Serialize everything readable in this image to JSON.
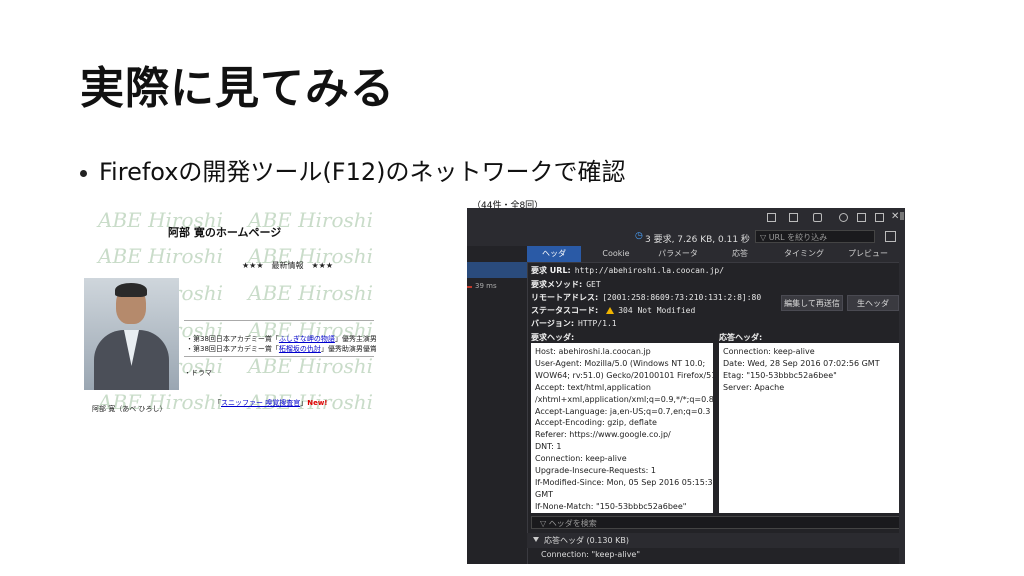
{
  "slide": {
    "title": "実際に見てみる",
    "bullet": "Firefoxの開発ツール(F12)のネットワークで確認"
  },
  "homepage": {
    "title": "阿部 寛のホームページ",
    "latest": "★★★　最新情報　★★★",
    "watermark": "ABE Hiroshi",
    "awards": [
      {
        "prefix": "・第38回日本アカデミー賞「",
        "link": "ふしぎな岬の物語",
        "suffix": "」優秀主演男優賞　受賞"
      },
      {
        "prefix": "・第38回日本アカデミー賞「",
        "link": "柘榴坂の仇討",
        "suffix": "」優秀助演男優賞　受賞"
      }
    ],
    "drama": "・ドラマ",
    "sniffer": {
      "prefix": "「",
      "link": "スニッファー 嗅覚捜査官",
      "suffix": "」",
      "new": "New!"
    },
    "name": "阿部 寛（あべ ひろし）"
  },
  "devtools": {
    "above_text": "（44件・全8回）",
    "stats": "3 要求, 7.26 KB, 0.11 秒",
    "filter_placeholder": "URL を絞り込み",
    "timing_left": "39 ms",
    "tabs": [
      "ヘッダ",
      "Cookie",
      "パラメータ",
      "応答",
      "タイミング",
      "プレビュー"
    ],
    "active_tab": "ヘッダ",
    "request_url": {
      "label": "要求 URL:",
      "value": "http://abehiroshi.la.coocan.jp/"
    },
    "request_method": {
      "label": "要求メソッド:",
      "value": "GET"
    },
    "remote_address": {
      "label": "リモートアドレス:",
      "value": "[2001:258:8609:73:210:131:2:8]:80"
    },
    "status_code": {
      "label": "ステータスコード:",
      "value": "304  Not Modified"
    },
    "version": {
      "label": "バージョン:",
      "value": "HTTP/1.1"
    },
    "buttons": {
      "edit_resend": "編集して再送信",
      "raw_headers": "生ヘッダ"
    },
    "request_headers_label": "要求ヘッダ:",
    "response_headers_label": "応答ヘッダ:",
    "request_headers": [
      "Host: abehiroshi.la.coocan.jp",
      "User-Agent: Mozilla/5.0 (Windows NT 10.0;",
      "WOW64; rv:51.0) Gecko/20100101 Firefox/51.0",
      "Accept: text/html,application",
      "/xhtml+xml,application/xml;q=0.9,*/*;q=0.8",
      "Accept-Language: ja,en-US;q=0.7,en;q=0.3",
      "Accept-Encoding: gzip, deflate",
      "Referer: https://www.google.co.jp/",
      "DNT: 1",
      "Connection: keep-alive",
      "Upgrade-Insecure-Requests: 1",
      "If-Modified-Since: Mon, 05 Sep 2016 05:15:36",
      "GMT",
      "If-None-Match: \"150-53bbbc52a6bee\""
    ],
    "response_headers": [
      "Connection: keep-alive",
      "Date: Wed, 28 Sep 2016 07:02:56 GMT",
      "Etag: \"150-53bbbc52a6bee\"",
      "Server: Apache"
    ],
    "search_placeholder": "ヘッダを検索",
    "response_section": "応答ヘッダ (0.130 KB)",
    "response_connection": "Connection: \"keep-alive\""
  }
}
